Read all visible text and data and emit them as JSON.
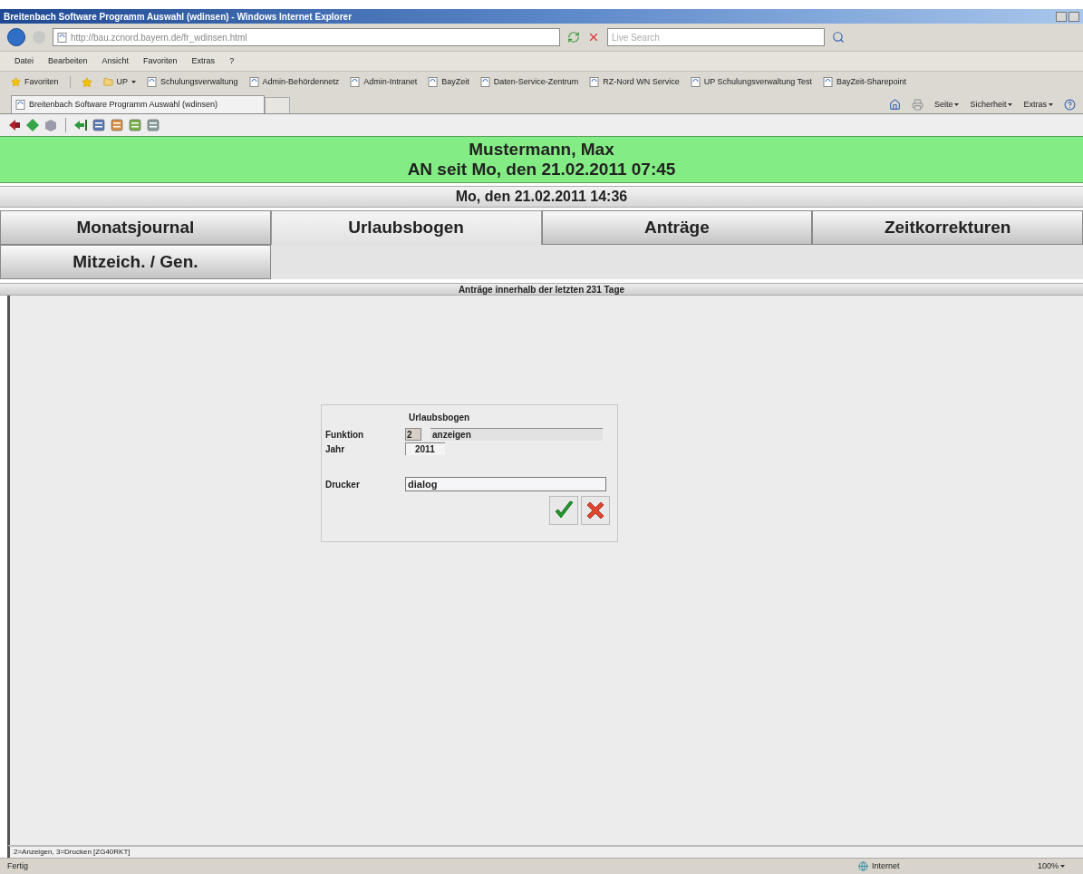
{
  "window": {
    "title": "Breitenbach Software Programm Auswahl (wdinsen) - Windows Internet Explorer"
  },
  "address_bar": {
    "url": "http://bau.zcnord.bayern.de/fr_wdinsen.html"
  },
  "search": {
    "placeholder": "Live Search"
  },
  "menu": [
    "Datei",
    "Bearbeiten",
    "Ansicht",
    "Favoriten",
    "Extras",
    "?"
  ],
  "favorites_bar": {
    "button": "Favoriten",
    "folder": "UP",
    "links": [
      "Schulungsverwaltung",
      "Admin-Behördennetz",
      "Admin-Intranet",
      "BayZeit",
      "Daten-Service-Zentrum",
      "RZ-Nord WN Service",
      "UP Schulungsverwaltung Test",
      "BayZeit-Sharepoint"
    ]
  },
  "browser_tab": {
    "title": "Breitenbach Software Programm Auswahl (wdinsen)"
  },
  "command_bar": [
    "Seite",
    "Sicherheit",
    "Extras"
  ],
  "header": {
    "name": "Mustermann, Max",
    "since": "AN seit Mo, den 21.02.2011 07:45",
    "date": "Mo, den 21.02.2011 14:36"
  },
  "app_tabs": [
    {
      "label": "Monatsjournal",
      "selected": false
    },
    {
      "label": "Urlaubsbogen",
      "selected": true
    },
    {
      "label": "Anträge",
      "selected": false
    },
    {
      "label": "Zeitkorrekturen",
      "selected": false
    },
    {
      "label": "Mitzeich. / Gen.",
      "selected": false
    }
  ],
  "subtitle": "Anträge innerhalb der letzten 231 Tage",
  "dialog": {
    "title": "Urlaubsbogen",
    "funktion": {
      "label": "Funktion",
      "code": "2",
      "value": "anzeigen"
    },
    "jahr": {
      "label": "Jahr",
      "value": "2011"
    },
    "drucker": {
      "label": "Drucker",
      "value": "dialog"
    }
  },
  "hint": "2=Anzeigen, 3=Drucken [ZG40RKT]",
  "status_bar": {
    "text": "Fertig",
    "zone": "Internet",
    "zoom": "100%"
  }
}
